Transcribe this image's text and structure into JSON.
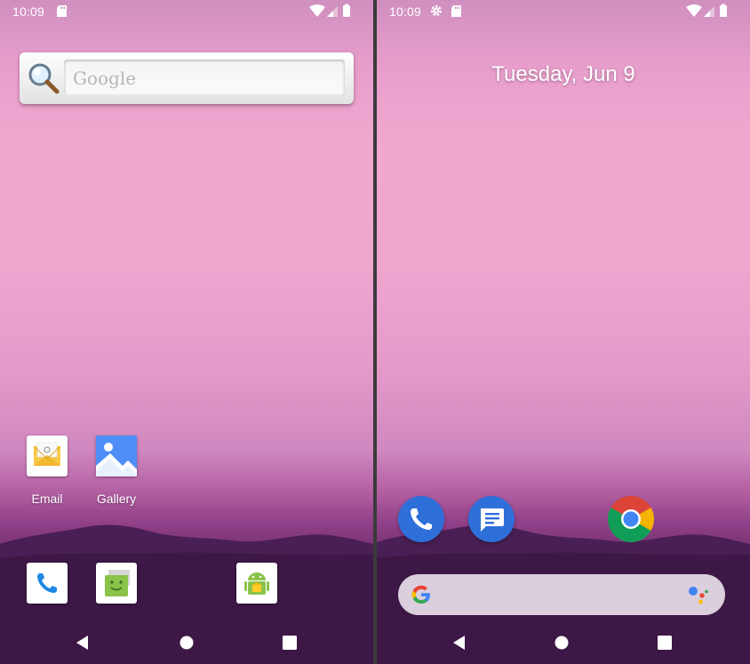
{
  "left_screen": {
    "status_bar": {
      "time": "10:09"
    },
    "search_widget": {
      "placeholder": "Google"
    },
    "apps": [
      {
        "label": "Email",
        "icon": "email-icon"
      },
      {
        "label": "Gallery",
        "icon": "gallery-icon"
      }
    ],
    "dock": [
      "phone-icon",
      "messaging-icon",
      "android-app-icon"
    ],
    "nav": [
      "back-icon",
      "home-icon",
      "recents-icon"
    ]
  },
  "right_screen": {
    "status_bar": {
      "time": "10:09"
    },
    "date": "Tuesday, Jun 9",
    "dock": [
      "phone-icon",
      "messages-icon",
      "chrome-icon"
    ],
    "search_bar": {
      "icons": [
        "google-g-icon",
        "google-assistant-icon"
      ]
    },
    "nav": [
      "back-icon",
      "home-icon",
      "recents-icon"
    ]
  },
  "colors": {
    "wallpaper_top": "#f0a8d0",
    "wallpaper_bottom": "#3f1a44",
    "dock_blue": "#1a73e8",
    "chrome_red": "#db4437",
    "chrome_yellow": "#f4b400",
    "chrome_green": "#0f9d58"
  }
}
